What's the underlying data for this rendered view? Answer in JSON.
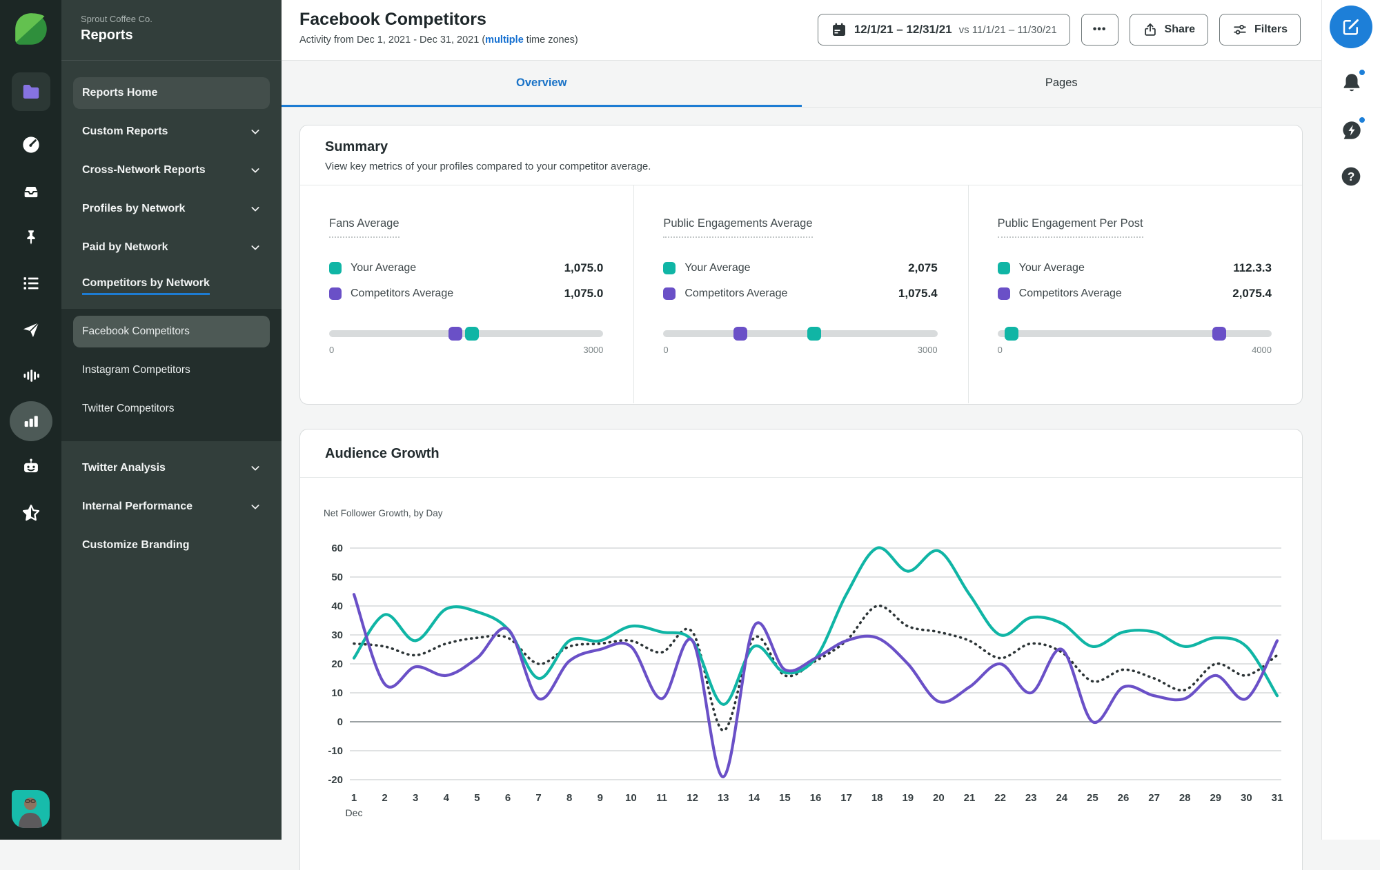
{
  "colors": {
    "accent_blue": "#1d7cd3",
    "teal": "#10b5a5",
    "purple": "#6a50c7",
    "rail_bg": "#1c2725",
    "sidebar_bg": "#323e3b",
    "sidebar_sub_bg": "#232e2c",
    "content_bg": "#f4f5f5",
    "leaf_green": "#46a64b"
  },
  "left_rail": {
    "icons": [
      {
        "name": "sprout-logo"
      },
      {
        "name": "folder",
        "section_active": true
      },
      {
        "name": "dashboard-gauge"
      },
      {
        "name": "inbox-tray"
      },
      {
        "name": "pin"
      },
      {
        "name": "tasks-list"
      },
      {
        "name": "publish-plane"
      },
      {
        "name": "listening-waveform"
      },
      {
        "name": "reports-bars",
        "selected": true
      },
      {
        "name": "automation-bot"
      },
      {
        "name": "reviews-star"
      }
    ]
  },
  "sidebar": {
    "company": "Sprout Coffee Co.",
    "title": "Reports",
    "items": [
      {
        "label": "Reports Home",
        "state": "active-pill"
      },
      {
        "label": "Custom Reports",
        "chevron": true
      },
      {
        "label": "Cross-Network Reports",
        "chevron": true
      },
      {
        "label": "Profiles by Network",
        "chevron": true
      },
      {
        "label": "Paid by Network",
        "chevron": true
      },
      {
        "label": "Competitors by Network",
        "state": "active-section"
      }
    ],
    "sub_items": [
      {
        "label": "Facebook Competitors",
        "state": "selected"
      },
      {
        "label": "Instagram Competitors"
      },
      {
        "label": "Twitter Competitors"
      }
    ],
    "items_after": [
      {
        "label": "Twitter Analysis",
        "chevron": true
      },
      {
        "label": "Internal Performance",
        "chevron": true
      },
      {
        "label": "Customize Branding"
      }
    ]
  },
  "header": {
    "title": "Facebook Competitors",
    "subtitle_prefix": "Activity from Dec 1, 2021 - Dec 31, 2021 (",
    "subtitle_link": "multiple",
    "subtitle_suffix": " time zones)",
    "date_range": {
      "primary": "12/1/21 – 12/31/21",
      "compare": "vs 11/1/21 – 11/30/21"
    },
    "more_label": "•••",
    "share_label": "Share",
    "filters_label": "Filters"
  },
  "tabs": {
    "overview": "Overview",
    "pages": "Pages"
  },
  "summary": {
    "title": "Summary",
    "description": "View key metrics of your profiles compared to your competitor average.",
    "metrics": [
      {
        "title": "Fans Average",
        "rows": [
          {
            "label": "Your Average",
            "value": "1,075.0",
            "swatch": "teal"
          },
          {
            "label": "Competitors Average",
            "value": "1,075.0",
            "swatch": "purple"
          }
        ],
        "slider": {
          "min": "0",
          "max": "3000",
          "handles": [
            {
              "swatch": "purple",
              "pct": 46
            },
            {
              "swatch": "teal",
              "pct": 52
            }
          ]
        }
      },
      {
        "title": "Public Engagements Average",
        "rows": [
          {
            "label": "Your Average",
            "value": "2,075",
            "swatch": "teal"
          },
          {
            "label": "Competitors Average",
            "value": "1,075.4",
            "swatch": "purple"
          }
        ],
        "slider": {
          "min": "0",
          "max": "3000",
          "handles": [
            {
              "swatch": "purple",
              "pct": 28
            },
            {
              "swatch": "teal",
              "pct": 55
            }
          ]
        }
      },
      {
        "title": "Public Engagement Per Post",
        "rows": [
          {
            "label": "Your Average",
            "value": "112.3.3",
            "swatch": "teal"
          },
          {
            "label": "Competitors Average",
            "value": "2,075.4",
            "swatch": "purple"
          }
        ],
        "slider": {
          "min": "0",
          "max": "4000",
          "handles": [
            {
              "swatch": "teal",
              "pct": 5
            },
            {
              "swatch": "purple",
              "pct": 81
            }
          ]
        }
      }
    ]
  },
  "audience_growth": {
    "title": "Audience Growth",
    "subtitle": "Net Follower Growth, by Day"
  },
  "chart_data": {
    "type": "line",
    "title": "Audience Growth",
    "subtitle": "Net Follower Growth, by Day",
    "x": [
      1,
      2,
      3,
      4,
      5,
      6,
      7,
      8,
      9,
      10,
      11,
      12,
      13,
      14,
      15,
      16,
      17,
      18,
      19,
      20,
      21,
      22,
      23,
      24,
      25,
      26,
      27,
      28,
      29,
      30,
      31
    ],
    "xlabel": "Dec",
    "ylim": [
      -20,
      60
    ],
    "yticks": [
      60,
      50,
      40,
      30,
      20,
      10,
      0,
      -10,
      -20
    ],
    "grid": "horizontal",
    "legend_visible": false,
    "series": [
      {
        "name": "Your Average",
        "style": "solid",
        "color": "#10b5a5",
        "values": [
          22,
          37,
          28,
          39,
          38,
          32,
          15,
          28,
          28,
          33,
          31,
          28,
          6,
          26,
          17,
          22,
          44,
          60,
          52,
          59,
          44,
          30,
          36,
          34,
          26,
          31,
          31,
          26,
          29,
          26,
          9
        ]
      },
      {
        "name": "Competitors Average",
        "style": "solid",
        "color": "#6a50c7",
        "values": [
          44,
          13,
          19,
          16,
          22,
          32,
          8,
          21,
          25,
          26,
          8,
          28,
          -19,
          33,
          18,
          22,
          28,
          29,
          20,
          7,
          12,
          20,
          10,
          25,
          0,
          12,
          9,
          8,
          16,
          8,
          28
        ]
      },
      {
        "name": "Average",
        "style": "dotted",
        "color": "#2c3436",
        "values": [
          27,
          26,
          23,
          27,
          29,
          29,
          20,
          26,
          27,
          28,
          24,
          31,
          -3,
          29,
          16,
          21,
          28,
          40,
          33,
          31,
          28,
          22,
          27,
          24,
          14,
          18,
          15,
          11,
          20,
          16,
          23
        ]
      }
    ]
  },
  "right_rail": {
    "icons": [
      {
        "name": "compose"
      },
      {
        "name": "notifications-bell",
        "badge": true
      },
      {
        "name": "feedback-chat",
        "badge": true
      },
      {
        "name": "help"
      }
    ]
  }
}
